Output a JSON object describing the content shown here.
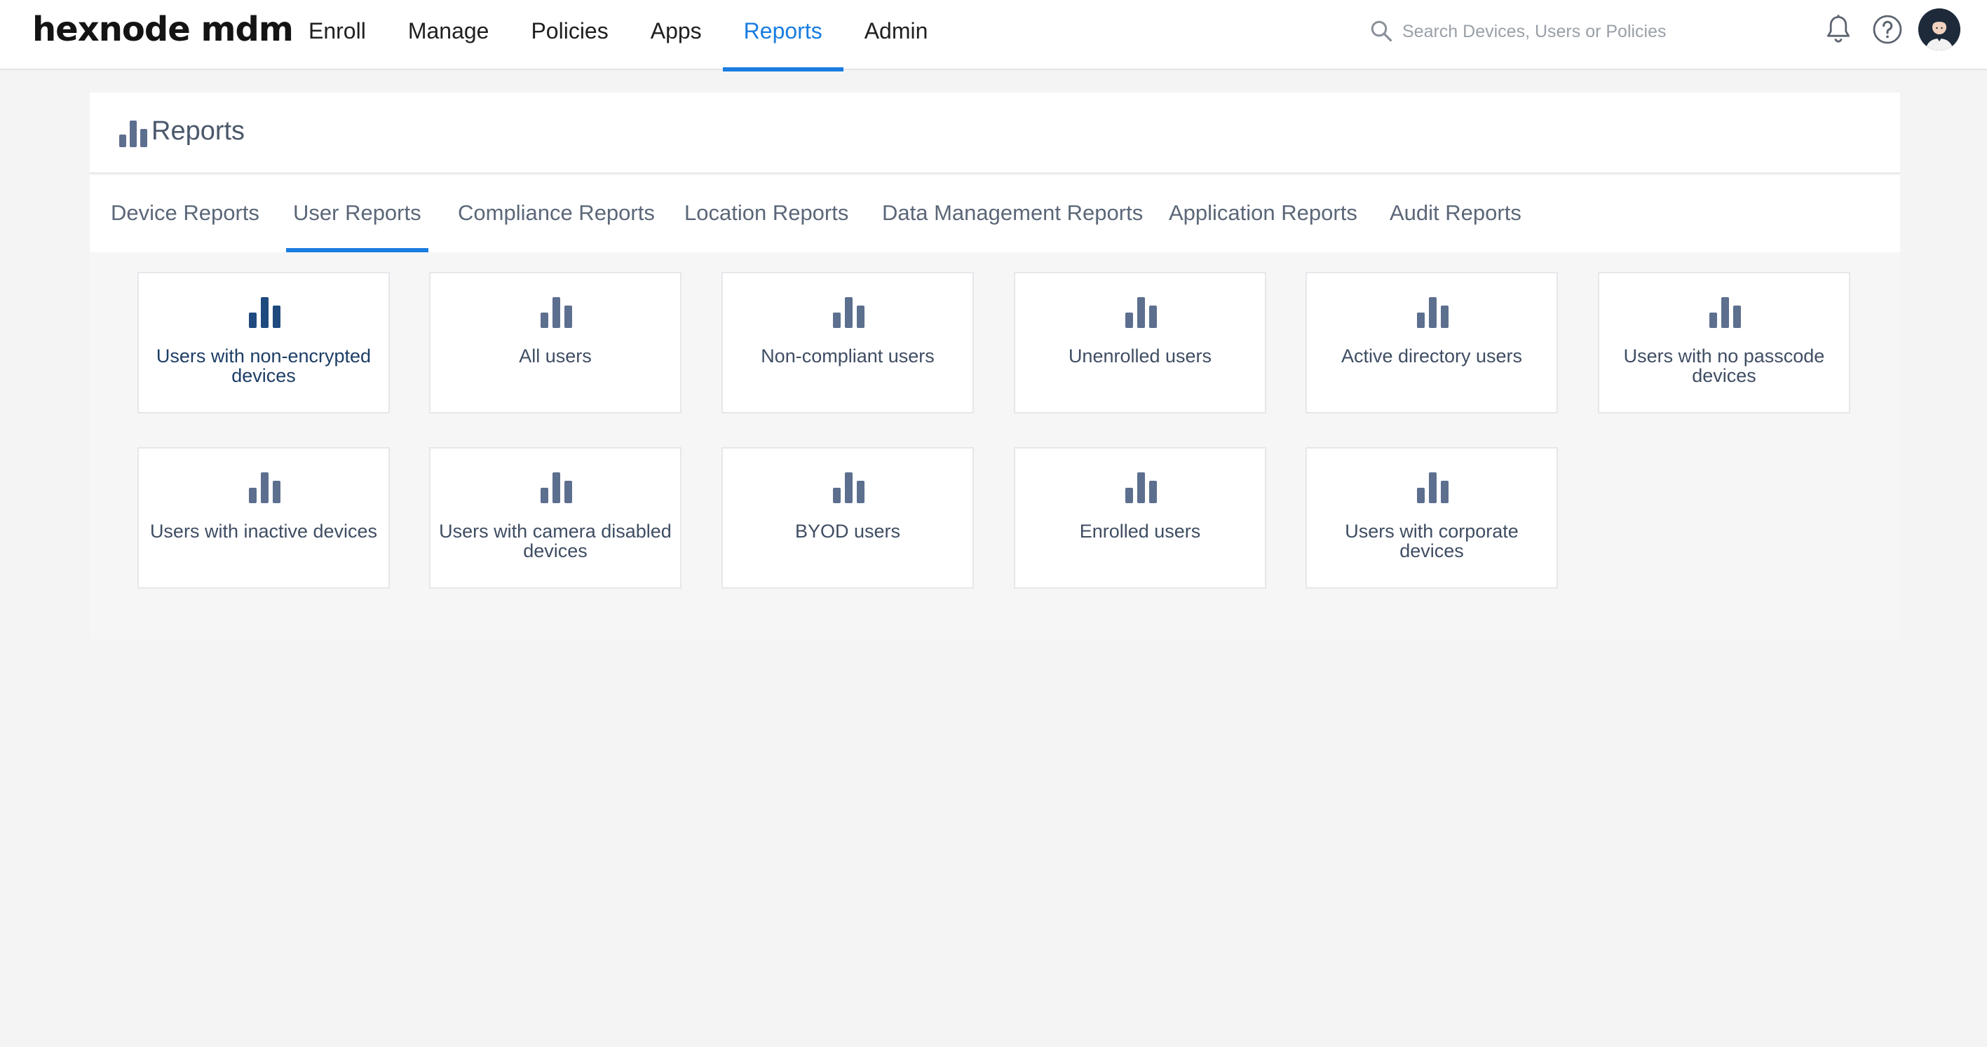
{
  "brand": {
    "logo_text": "hexnode mdm"
  },
  "nav": {
    "items": [
      {
        "label": "Enroll"
      },
      {
        "label": "Manage"
      },
      {
        "label": "Policies"
      },
      {
        "label": "Apps"
      },
      {
        "label": "Reports",
        "active": true
      },
      {
        "label": "Admin"
      }
    ]
  },
  "search": {
    "placeholder": "Search Devices, Users or Policies",
    "value": ""
  },
  "page": {
    "title": "Reports"
  },
  "tabs": [
    {
      "label": "Device Reports"
    },
    {
      "label": "User Reports",
      "active": true
    },
    {
      "label": "Compliance Reports"
    },
    {
      "label": "Location Reports"
    },
    {
      "label": "Data Management Reports"
    },
    {
      "label": "Application Reports"
    },
    {
      "label": "Audit Reports"
    }
  ],
  "reports": [
    {
      "label": "Users with non-encrypted devices",
      "highlighted": true
    },
    {
      "label": "All users"
    },
    {
      "label": "Non-compliant users"
    },
    {
      "label": "Unenrolled users"
    },
    {
      "label": "Active directory users"
    },
    {
      "label": "Users with no passcode devices"
    },
    {
      "label": "Users with inactive devices"
    },
    {
      "label": "Users with camera disabled devices"
    },
    {
      "label": "BYOD users"
    },
    {
      "label": "Enrolled users"
    },
    {
      "label": "Users with corporate devices"
    }
  ],
  "colors": {
    "accent": "#1a7de0",
    "icon": "#5d6f8f",
    "icon_highlight": "#1e4a7e",
    "background": "#f4f4f4"
  }
}
